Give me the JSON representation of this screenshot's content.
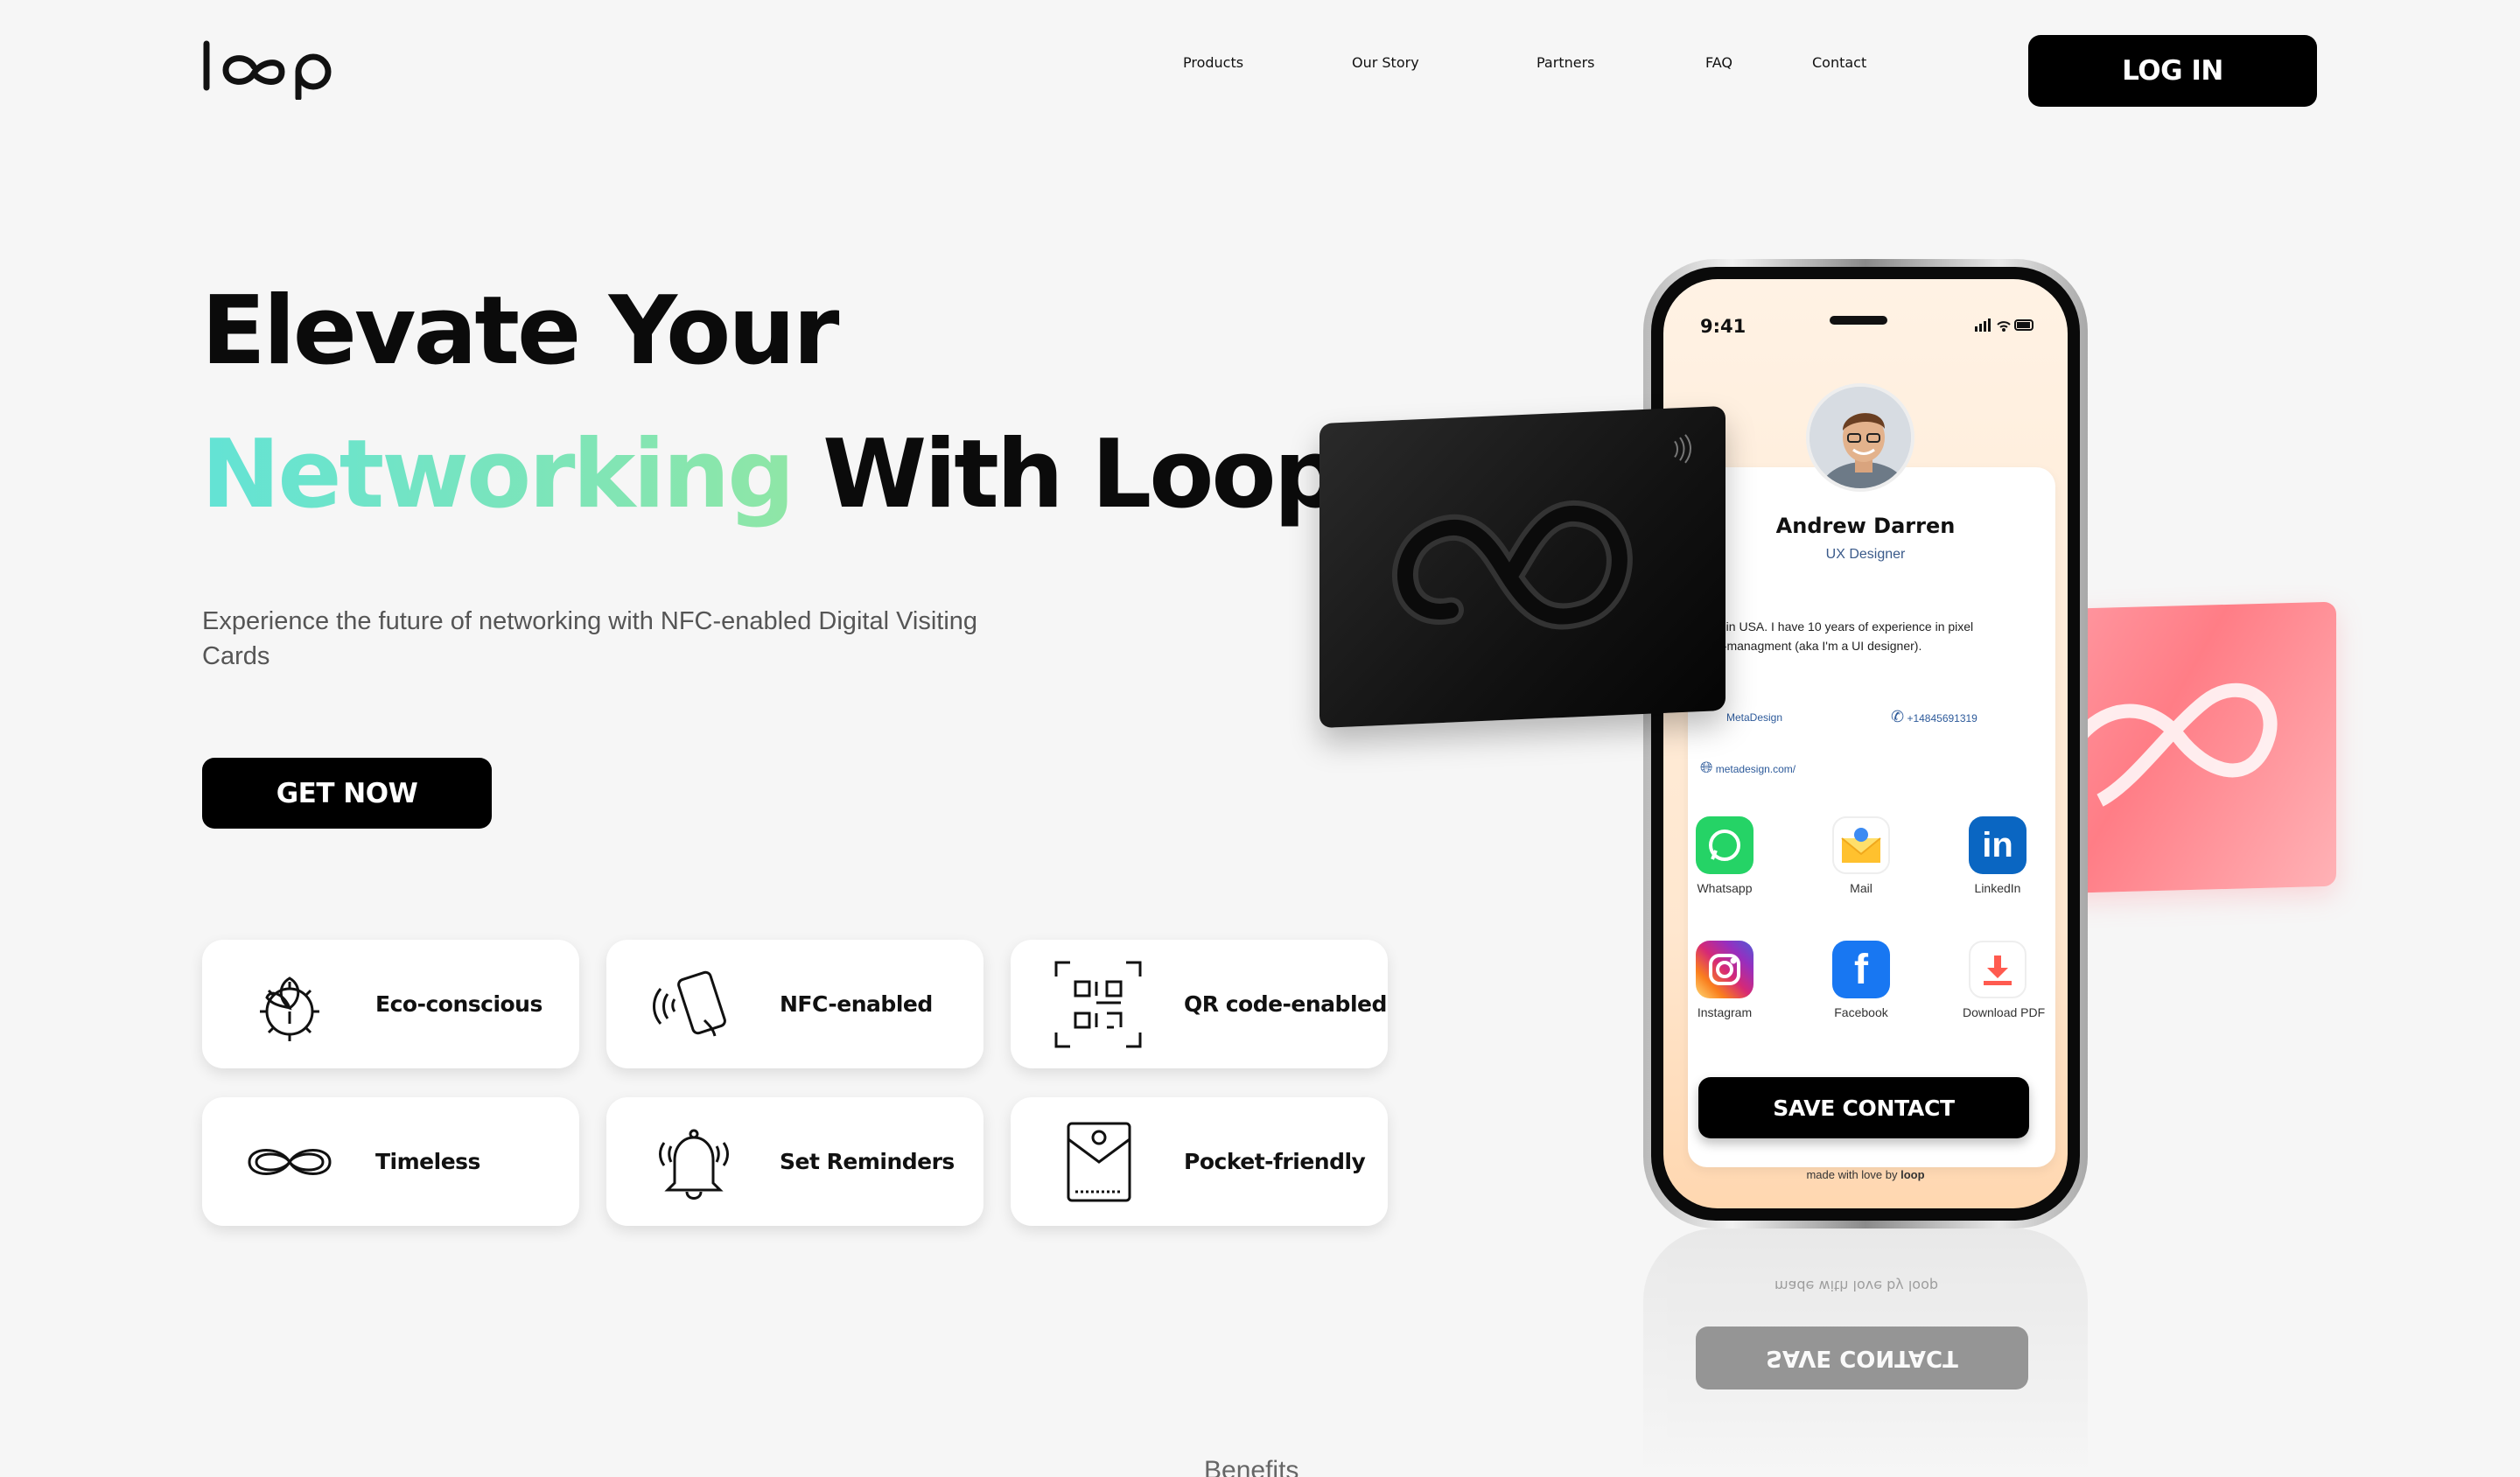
{
  "brand": {
    "logo_text": "loop"
  },
  "nav": {
    "items": [
      {
        "label": "Products"
      },
      {
        "label": "Our Story"
      },
      {
        "label": "Partners"
      },
      {
        "label": "FAQ"
      },
      {
        "label": "Contact"
      }
    ],
    "login_label": "LOG IN"
  },
  "hero": {
    "title_line1": "Elevate Your",
    "title_highlight": "Networking",
    "title_line2_rest": "With Loop.",
    "subtitle": "Experience the future of networking with NFC-enabled Digital Visiting Cards",
    "cta_label": "GET NOW"
  },
  "features": [
    {
      "label": "Eco-conscious",
      "icon": "eco-gear-icon"
    },
    {
      "label": "NFC-enabled",
      "icon": "nfc-phone-icon"
    },
    {
      "label": "QR code-enabled",
      "icon": "qr-code-icon"
    },
    {
      "label": "Timeless",
      "icon": "infinity-icon"
    },
    {
      "label": "Set Reminders",
      "icon": "bell-icon"
    },
    {
      "label": "Pocket-friendly",
      "icon": "pocket-icon"
    }
  ],
  "benefits_heading": "Benefits",
  "phone": {
    "status_time": "9:41",
    "profile": {
      "name": "Andrew Darren",
      "role": "UX Designer",
      "bio": "d in USA. I have 10 years of experience in pixel\no-managment (aka I'm a UI designer).",
      "company": "MetaDesign",
      "phone": "+14845691319",
      "website": "metadesign.com/"
    },
    "apps": [
      {
        "label": "Whatsapp",
        "color": "#25d366"
      },
      {
        "label": "Mail",
        "color": "#ffd24a"
      },
      {
        "label": "LinkedIn",
        "color": "#0a66c2"
      },
      {
        "label": "Instagram",
        "color": "#d6249f"
      },
      {
        "label": "Facebook",
        "color": "#1877f2"
      },
      {
        "label": "Download PDF",
        "color": "#ff5a4f"
      }
    ],
    "save_label": "SAVE CONTACT",
    "made_with": "made with love by",
    "made_with_brand": "loop"
  },
  "colors": {
    "accent_gradient_start": "#63e3d5",
    "accent_gradient_end": "#8fe6a6",
    "button_bg": "#000000",
    "page_bg": "#f6f6f6",
    "pink_card": "#ff8a93"
  }
}
